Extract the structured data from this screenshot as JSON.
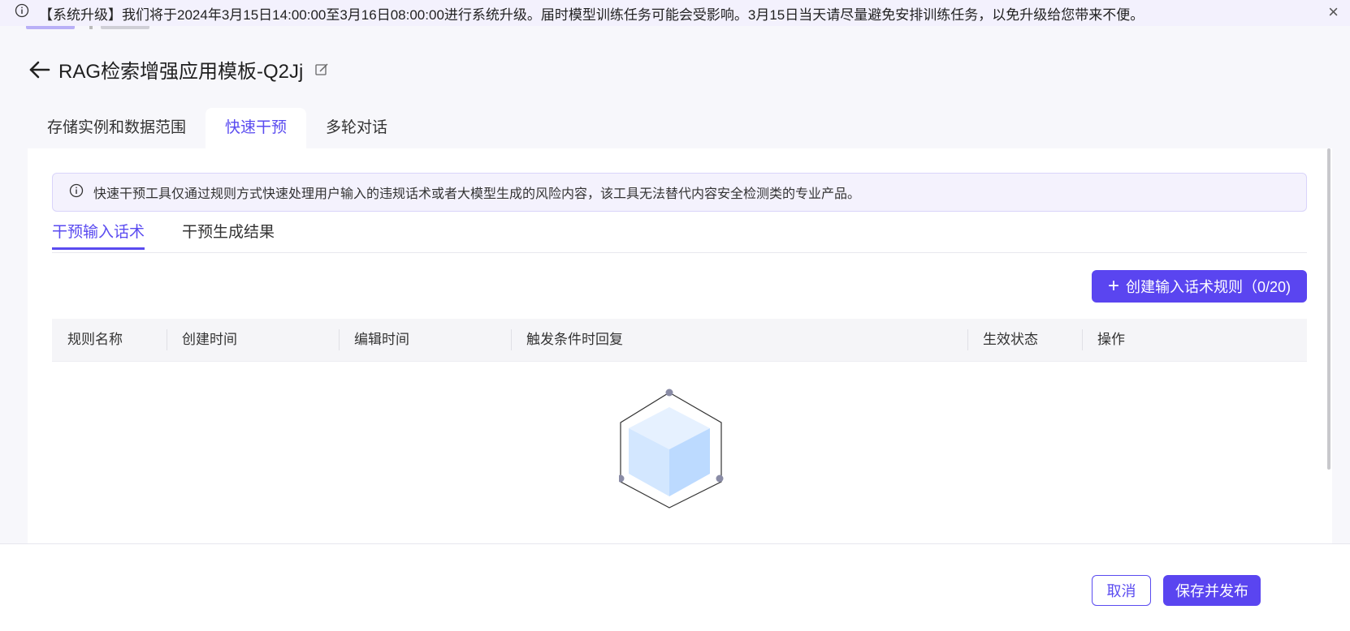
{
  "banner": {
    "text": "【系统升级】我们将于2024年3月15日14:00:00至3月16日08:00:00进行系统升级。届时模型训练任务可能会受影响。3月15日当天请尽量避免安排训练任务，以免升级给您带来不便。",
    "close_symbol": "×"
  },
  "header": {
    "title": "RAG检索增强应用模板-Q2Jj"
  },
  "tabs": [
    {
      "label": "存储实例和数据范围"
    },
    {
      "label": "快速干预"
    },
    {
      "label": "多轮对话"
    }
  ],
  "notice": {
    "text": "快速干预工具仅通过规则方式快速处理用户输入的违规话术或者大模型生成的风险内容，该工具无法替代内容安全检测类的专业产品。"
  },
  "subtabs": [
    {
      "label": "干预输入话术"
    },
    {
      "label": "干预生成结果"
    }
  ],
  "create_button": {
    "plus": "+",
    "label": "创建输入话术规则（0/20)"
  },
  "table": {
    "columns": [
      "规则名称",
      "创建时间",
      "编辑时间",
      "触发条件时回复",
      "生效状态",
      "操作"
    ]
  },
  "footer": {
    "cancel_label": "取消",
    "save_label": "保存并发布"
  },
  "colors": {
    "accent": "#5a45f0",
    "banner_bg": "#f3f1fd",
    "notice_bg": "#f4f2fd"
  },
  "icons": [
    "info-icon",
    "close-icon",
    "back-arrow-icon",
    "edit-icon",
    "plus-icon",
    "empty-box-icon"
  ]
}
